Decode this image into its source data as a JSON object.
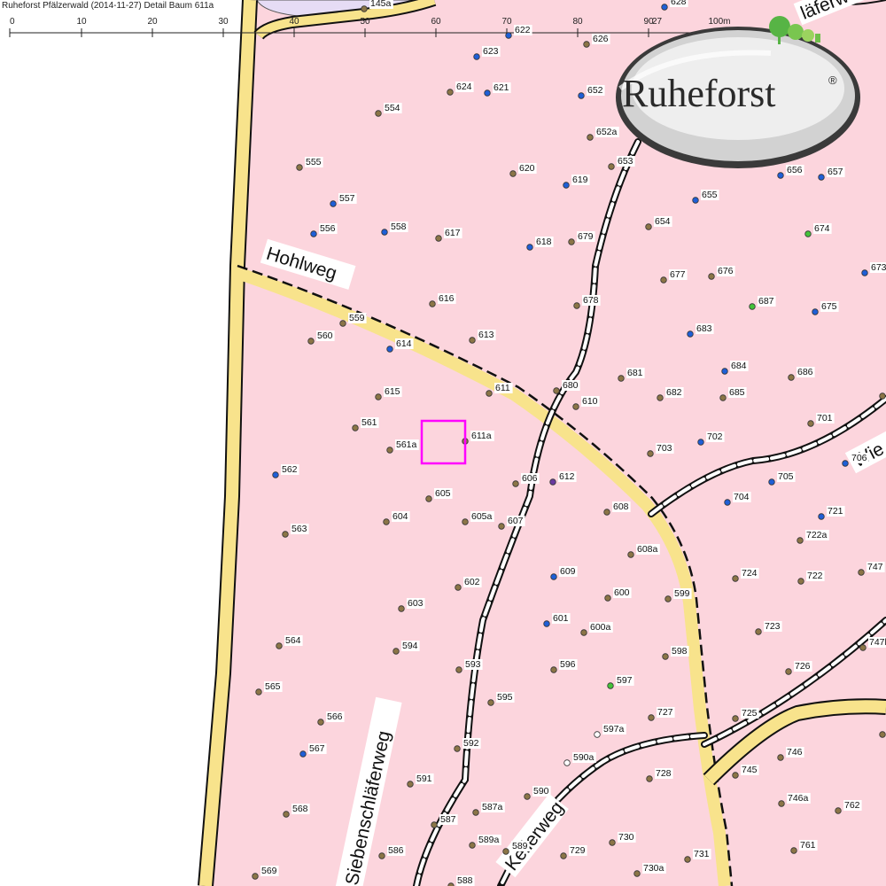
{
  "header": {
    "title": "Ruheforst Pfälzerwald (2014-11-27) Detail  Baum 611a"
  },
  "scale": {
    "ticks": [
      "0",
      "10",
      "20",
      "30",
      "40",
      "50",
      "60",
      "70",
      "80",
      "90",
      "100m"
    ],
    "partial_label": "27"
  },
  "logo": {
    "text": "Ruheforst",
    "mark": "®"
  },
  "roads": [
    {
      "id": "hohlweg",
      "name": "Hohlweg"
    },
    {
      "id": "siebenschlaeferweg",
      "name": "Siebenschläferweg"
    },
    {
      "id": "keilerweg",
      "name": "Keilerweg"
    },
    {
      "id": "wiesenweg",
      "name": "Wie"
    },
    {
      "id": "top-right-road",
      "name": "läferw"
    }
  ],
  "colors": {
    "forest": "#fcd5dd",
    "road_fill": "#f8e38c",
    "path_dash": "#111111",
    "selection": "#ff00ff",
    "tree_brown": "#8b7547",
    "tree_blue": "#1f5fd6",
    "tree_green": "#44c23a",
    "tree_purple": "#6a3aa0",
    "tree_white": "#ffffff"
  },
  "selected_tree": "611a",
  "trees": [
    {
      "label": "145a",
      "color": "brown"
    },
    {
      "label": "628",
      "color": "blue"
    },
    {
      "label": "630",
      "color": "blue"
    },
    {
      "label": "622",
      "color": "blue"
    },
    {
      "label": "626",
      "color": "brown"
    },
    {
      "label": "623",
      "color": "blue"
    },
    {
      "label": "624",
      "color": "brown"
    },
    {
      "label": "621",
      "color": "blue"
    },
    {
      "label": "652",
      "color": "blue"
    },
    {
      "label": "554",
      "color": "brown"
    },
    {
      "label": "652a",
      "color": "brown"
    },
    {
      "label": "653",
      "color": "brown"
    },
    {
      "label": "555",
      "color": "brown"
    },
    {
      "label": "620",
      "color": "brown"
    },
    {
      "label": "619",
      "color": "blue"
    },
    {
      "label": "656",
      "color": "blue"
    },
    {
      "label": "657",
      "color": "blue"
    },
    {
      "label": "557",
      "color": "blue"
    },
    {
      "label": "655",
      "color": "blue"
    },
    {
      "label": "556",
      "color": "blue"
    },
    {
      "label": "558",
      "color": "blue"
    },
    {
      "label": "617",
      "color": "brown"
    },
    {
      "label": "618",
      "color": "blue"
    },
    {
      "label": "679",
      "color": "brown"
    },
    {
      "label": "654",
      "color": "brown"
    },
    {
      "label": "674",
      "color": "green"
    },
    {
      "label": "673",
      "color": "blue"
    },
    {
      "label": "677",
      "color": "brown"
    },
    {
      "label": "676",
      "color": "brown"
    },
    {
      "label": "616",
      "color": "brown"
    },
    {
      "label": "678",
      "color": "brown"
    },
    {
      "label": "687",
      "color": "green"
    },
    {
      "label": "675",
      "color": "blue"
    },
    {
      "label": "559",
      "color": "brown"
    },
    {
      "label": "560",
      "color": "brown"
    },
    {
      "label": "613",
      "color": "brown"
    },
    {
      "label": "614",
      "color": "blue"
    },
    {
      "label": "683",
      "color": "blue"
    },
    {
      "label": "684",
      "color": "blue"
    },
    {
      "label": "686",
      "color": "brown"
    },
    {
      "label": "681",
      "color": "brown"
    },
    {
      "label": "615",
      "color": "brown"
    },
    {
      "label": "611",
      "color": "brown"
    },
    {
      "label": "680",
      "color": "brown"
    },
    {
      "label": "682",
      "color": "brown"
    },
    {
      "label": "685",
      "color": "brown"
    },
    {
      "label": "610",
      "color": "brown"
    },
    {
      "label": "701",
      "color": "brown"
    },
    {
      "label": "561",
      "color": "brown"
    },
    {
      "label": "611a",
      "color": "brown"
    },
    {
      "label": "561a",
      "color": "brown"
    },
    {
      "label": "703",
      "color": "brown"
    },
    {
      "label": "702",
      "color": "blue"
    },
    {
      "label": "706",
      "color": "blue"
    },
    {
      "label": "562",
      "color": "blue"
    },
    {
      "label": "606",
      "color": "brown"
    },
    {
      "label": "612",
      "color": "purple"
    },
    {
      "label": "705",
      "color": "blue"
    },
    {
      "label": "605",
      "color": "brown"
    },
    {
      "label": "704",
      "color": "blue"
    },
    {
      "label": "608",
      "color": "brown"
    },
    {
      "label": "721",
      "color": "blue"
    },
    {
      "label": "604",
      "color": "brown"
    },
    {
      "label": "605a",
      "color": "brown"
    },
    {
      "label": "607",
      "color": "brown"
    },
    {
      "label": "563",
      "color": "brown"
    },
    {
      "label": "722a",
      "color": "brown"
    },
    {
      "label": "608a",
      "color": "brown"
    },
    {
      "label": "609",
      "color": "blue"
    },
    {
      "label": "724",
      "color": "brown"
    },
    {
      "label": "722",
      "color": "brown"
    },
    {
      "label": "747",
      "color": "brown"
    },
    {
      "label": "602",
      "color": "brown"
    },
    {
      "label": "600",
      "color": "brown"
    },
    {
      "label": "599",
      "color": "brown"
    },
    {
      "label": "603",
      "color": "brown"
    },
    {
      "label": "601",
      "color": "blue"
    },
    {
      "label": "600a",
      "color": "brown"
    },
    {
      "label": "723",
      "color": "brown"
    },
    {
      "label": "564",
      "color": "brown"
    },
    {
      "label": "594",
      "color": "brown"
    },
    {
      "label": "747b",
      "color": "brown"
    },
    {
      "label": "598",
      "color": "brown"
    },
    {
      "label": "593",
      "color": "brown"
    },
    {
      "label": "596",
      "color": "brown"
    },
    {
      "label": "726",
      "color": "brown"
    },
    {
      "label": "597",
      "color": "green"
    },
    {
      "label": "565",
      "color": "brown"
    },
    {
      "label": "595",
      "color": "brown"
    },
    {
      "label": "727",
      "color": "brown"
    },
    {
      "label": "725",
      "color": "brown"
    },
    {
      "label": "566",
      "color": "brown"
    },
    {
      "label": "597a",
      "color": "white"
    },
    {
      "label": "592",
      "color": "brown"
    },
    {
      "label": "567",
      "color": "blue"
    },
    {
      "label": "746",
      "color": "brown"
    },
    {
      "label": "590a",
      "color": "white"
    },
    {
      "label": "745",
      "color": "brown"
    },
    {
      "label": "728",
      "color": "brown"
    },
    {
      "label": "591",
      "color": "brown"
    },
    {
      "label": "590",
      "color": "brown"
    },
    {
      "label": "746a",
      "color": "brown"
    },
    {
      "label": "568",
      "color": "brown"
    },
    {
      "label": "587a",
      "color": "brown"
    },
    {
      "label": "762",
      "color": "brown"
    },
    {
      "label": "587",
      "color": "brown"
    },
    {
      "label": "730",
      "color": "brown"
    },
    {
      "label": "589a",
      "color": "brown"
    },
    {
      "label": "586",
      "color": "brown"
    },
    {
      "label": "589",
      "color": "brown"
    },
    {
      "label": "729",
      "color": "brown"
    },
    {
      "label": "761",
      "color": "brown"
    },
    {
      "label": "569",
      "color": "brown"
    },
    {
      "label": "731",
      "color": "brown"
    },
    {
      "label": "730a",
      "color": "brown"
    },
    {
      "label": "588",
      "color": "brown"
    },
    {
      "label": "70",
      "color": "brown"
    },
    {
      "label": "76",
      "color": "brown"
    }
  ]
}
